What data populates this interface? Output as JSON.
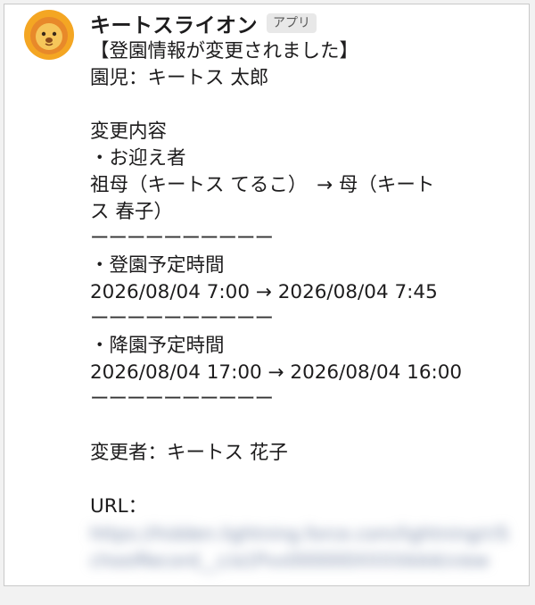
{
  "sender": {
    "name": "キートスライオン",
    "badge": "アプリ"
  },
  "message": {
    "heading": "【登園情報が変更されました】",
    "child_line": "園児：キートス 太郎",
    "changes_title": "変更内容",
    "pickup_label": "・お迎え者",
    "pickup_change_line1": "祖母（キートス てるこ）　→ 母（キート",
    "pickup_change_line2": "ス 春子）",
    "divider": "ーーーーーーーーーー",
    "arrival_label": "・登園予定時間",
    "arrival_change": "2026/08/04 7:00 → 2026/08/04 7:45",
    "departure_label": "・降園予定時間",
    "departure_change": "2026/08/04 17:00 → 2026/08/04 16:00",
    "changer_line": "変更者：キートス 花子",
    "url_label": "URL：",
    "url_value": "https://hidden.lightning.force.com/lightning/r/SchoolRecord__c/a1Pxx000000XXXXAAA/view"
  },
  "colors": {
    "avatar_bg": "#f4a623",
    "text": "#1d1c1d",
    "badge_bg": "#e8e8e8"
  }
}
